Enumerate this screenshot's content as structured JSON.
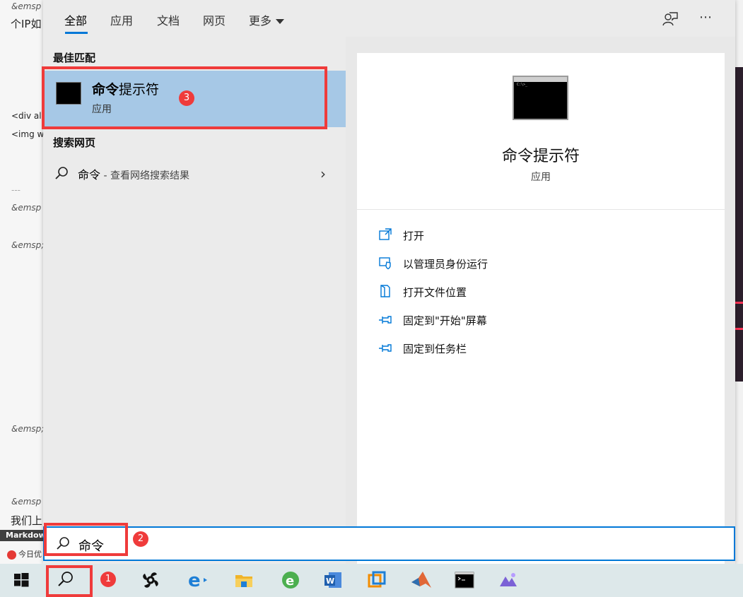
{
  "background_editor": {
    "lines": [
      "&emsp",
      "个IP如",
      "<div ali",
      "<img w",
      "---",
      "&emsp",
      "&emsp;",
      "&emsp;",
      "&emsp",
      "我们上"
    ],
    "statusbar_label": "Markdown",
    "today_label": "今日优"
  },
  "search": {
    "tabs": [
      "全部",
      "应用",
      "文档",
      "网页",
      "更多"
    ],
    "best_match_heading": "最佳匹配",
    "best_match": {
      "title_bold": "命令",
      "title_rest": "提示符",
      "subtitle": "应用"
    },
    "web_heading": "搜索网页",
    "web_query": "命令",
    "web_hint": " - 查看网络搜索结果",
    "preview": {
      "title": "命令提示符",
      "subtitle": "应用"
    },
    "actions": [
      "打开",
      "以管理员身份运行",
      "打开文件位置",
      "固定到\"开始\"屏幕",
      "固定到任务栏"
    ],
    "query": "命令"
  },
  "annotations": {
    "badge1": "1",
    "badge2": "2",
    "badge3": "3"
  },
  "colors": {
    "accent": "#0078d7",
    "highlight": "#a6c8e6",
    "annotation": "#ef3b3b"
  }
}
